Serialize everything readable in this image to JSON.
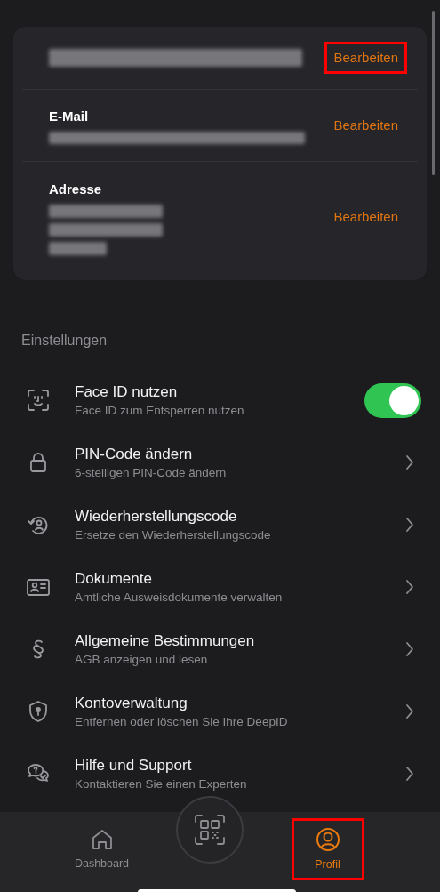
{
  "profile_card": {
    "rows": [
      {
        "lines": [
          {
            "kind": "redacted"
          }
        ],
        "action": "Bearbeiten",
        "highlighted": true
      },
      {
        "label": "E-Mail",
        "lines": [
          {
            "kind": "redacted"
          }
        ],
        "action": "Bearbeiten",
        "highlighted": false
      },
      {
        "label": "Adresse",
        "lines": [
          {
            "kind": "redacted"
          },
          {
            "kind": "redacted"
          },
          {
            "kind": "redacted"
          }
        ],
        "action": "Bearbeiten",
        "highlighted": false
      }
    ]
  },
  "settings": {
    "title": "Einstellungen",
    "items": [
      {
        "title": "Face ID nutzen",
        "subtitle": "Face ID zum Entsperren nutzen",
        "kind": "toggle",
        "on": true
      },
      {
        "title": "PIN-Code ändern",
        "subtitle": "6-stelligen PIN-Code ändern",
        "kind": "link"
      },
      {
        "title": "Wiederherstellungscode",
        "subtitle": "Ersetze den Wiederherstellungscode",
        "kind": "link"
      },
      {
        "title": "Dokumente",
        "subtitle": "Amtliche Ausweisdokumente verwalten",
        "kind": "link"
      },
      {
        "title": "Allgemeine Bestimmungen",
        "subtitle": "AGB anzeigen und lesen",
        "kind": "link"
      },
      {
        "title": "Kontoverwaltung",
        "subtitle": "Entfernen oder löschen Sie Ihre DeepID",
        "kind": "link"
      },
      {
        "title": "Hilfe und Support",
        "subtitle": "Kontaktieren Sie einen Experten",
        "kind": "link"
      }
    ]
  },
  "tab_bar": {
    "tabs": [
      {
        "kind": "home",
        "label": "Dashboard",
        "selected": false,
        "highlighted": false
      },
      {
        "kind": "scan",
        "selected": false,
        "highlighted": false
      },
      {
        "kind": "profile",
        "label": "Profil",
        "selected": true,
        "highlighted": true
      }
    ]
  }
}
